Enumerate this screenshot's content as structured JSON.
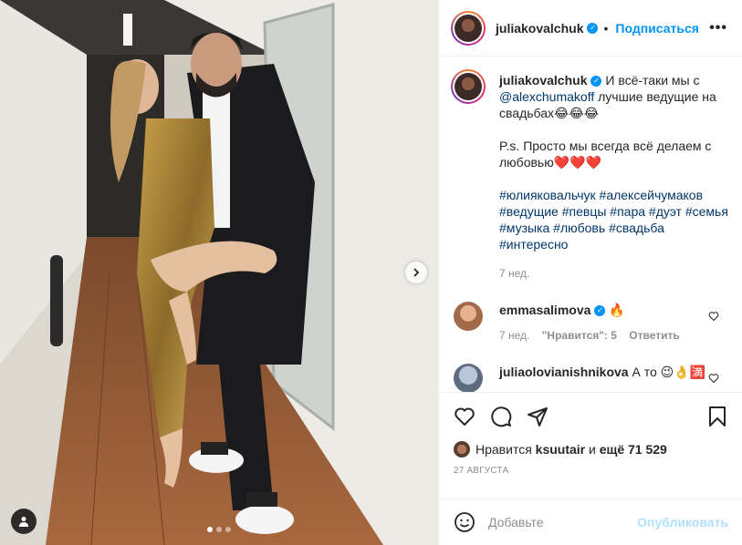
{
  "post": {
    "photo_alt": "",
    "carousel": {
      "count": 3,
      "active": 0
    }
  },
  "header": {
    "username": "juliakovalchuk",
    "verified": true,
    "separator": "•",
    "follow_label": "Подписаться",
    "more_label": "•••"
  },
  "caption": {
    "username": "juliakovalchuk",
    "text_1": " И всё-таки мы с ",
    "mention": "@alexchumakoff",
    "text_2": " лучшие ведущие на свадьбах😂😂😂",
    "ps": "P.s. Просто мы всегда всё делаем с любовью❤️❤️❤️",
    "hashtags": [
      "#юлияковальчук",
      "#алексейчумаков",
      "#ведущие",
      "#певцы",
      "#пара",
      "#дуэт",
      "#семья",
      "#музыка",
      "#любовь",
      "#свадьба",
      "#интересно"
    ],
    "time": "7 нед."
  },
  "comments": [
    {
      "username": "emmasalimova",
      "verified": true,
      "text": "🔥",
      "time": "7 нед.",
      "likes": "\"Нравится\": 5",
      "reply": "Ответить"
    },
    {
      "username": "juliaolovianishnikova",
      "verified": false,
      "text": "А то 😉👌🈵",
      "time": "",
      "likes": "",
      "reply": ""
    }
  ],
  "likes": {
    "prefix": "Нравится ",
    "user": "ksuutair",
    "middle": " и ",
    "rest": "ещё 71 529"
  },
  "date": "27 АВГУСТА",
  "add_comment": {
    "placeholder": "Добавьте",
    "post_label": "Опубликовать"
  },
  "colors": {
    "accent": "#0095f6",
    "link": "#00376b",
    "muted": "#8e8e8e"
  }
}
